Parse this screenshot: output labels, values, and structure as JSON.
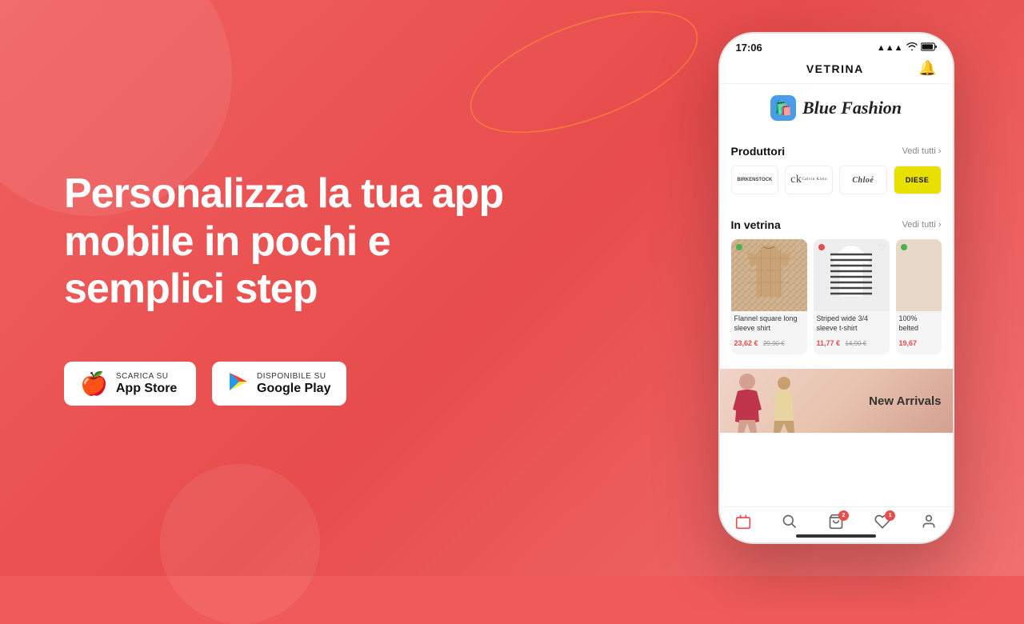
{
  "background": {
    "color": "#f05a5a"
  },
  "left": {
    "headline": "Personalizza la tua app mobile in pochi e semplici step",
    "appstore_button": {
      "pre_label": "Scarica su",
      "label": "App Store",
      "icon": "apple"
    },
    "googleplay_button": {
      "pre_label": "DISPONIBILE SU",
      "label": "Google Play",
      "icon": "google-play"
    }
  },
  "phone": {
    "status_bar": {
      "time": "17:06",
      "signal": "▲▲▲",
      "wifi": "wifi",
      "battery": "battery"
    },
    "header": {
      "title": "VETRINA",
      "bell_icon": "🔔"
    },
    "app_logo": {
      "name": "Blue Fashion",
      "icon": "🛍️"
    },
    "produttori_section": {
      "title": "Produttori",
      "link": "Vedi tutti",
      "brands": [
        {
          "name": "BIRKENSTOCK",
          "style": "normal"
        },
        {
          "name": "ck\nCalvin Klein",
          "style": "ck"
        },
        {
          "name": "Chloé",
          "style": "chloe"
        },
        {
          "name": "DIESE",
          "style": "diesel"
        }
      ]
    },
    "in_vetrina_section": {
      "title": "In vetrina",
      "link": "Vedi tutti",
      "products": [
        {
          "name": "Flannel square long sleeve shirt",
          "price": "23,62 €",
          "old_price": "29,90 €",
          "dot": "green"
        },
        {
          "name": "Striped wide 3/4 sleeve t-shirt",
          "price": "11,77 €",
          "old_price": "14,90 €",
          "dot": "red"
        },
        {
          "name": "100% belted",
          "price": "19,67",
          "old_price": "",
          "dot": "green"
        }
      ]
    },
    "banner": {
      "text": "New Arrivals"
    },
    "bottom_nav": {
      "items": [
        {
          "icon": "🏪",
          "label": "home",
          "active": true,
          "badge": null
        },
        {
          "icon": "🔍",
          "label": "search",
          "active": false,
          "badge": null
        },
        {
          "icon": "🛒",
          "label": "cart",
          "active": false,
          "badge": "2"
        },
        {
          "icon": "♡",
          "label": "wishlist",
          "active": false,
          "badge": "1"
        },
        {
          "icon": "👤",
          "label": "profile",
          "active": false,
          "badge": null
        }
      ]
    }
  }
}
